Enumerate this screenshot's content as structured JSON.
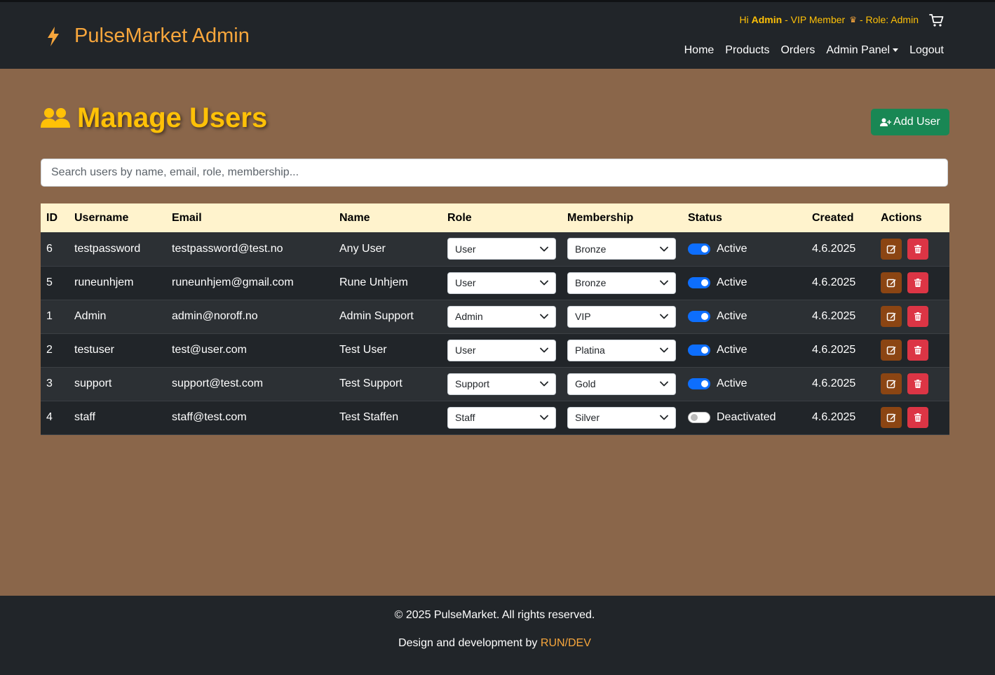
{
  "brand": {
    "title": "PulseMarket Admin"
  },
  "header": {
    "greeting_hi": "Hi",
    "user": "Admin",
    "membership_text": "- VIP Member",
    "role_text": "- Role: Admin"
  },
  "nav": {
    "home": "Home",
    "products": "Products",
    "orders": "Orders",
    "admin_panel": "Admin Panel",
    "logout": "Logout"
  },
  "page": {
    "title": "Manage Users",
    "add_user": "Add User"
  },
  "search": {
    "placeholder": "Search users by name, email, role, membership..."
  },
  "table": {
    "headers": [
      "ID",
      "Username",
      "Email",
      "Name",
      "Role",
      "Membership",
      "Status",
      "Created",
      "Actions"
    ],
    "rows": [
      {
        "id": "6",
        "username": "testpassword",
        "email": "testpassword@test.no",
        "name": "Any User",
        "role": "User",
        "membership": "Bronze",
        "status": "Active",
        "active": true,
        "created": "4.6.2025"
      },
      {
        "id": "5",
        "username": "runeunhjem",
        "email": "runeunhjem@gmail.com",
        "name": "Rune Unhjem",
        "role": "User",
        "membership": "Bronze",
        "status": "Active",
        "active": true,
        "created": "4.6.2025"
      },
      {
        "id": "1",
        "username": "Admin",
        "email": "admin@noroff.no",
        "name": "Admin Support",
        "role": "Admin",
        "membership": "VIP",
        "status": "Active",
        "active": true,
        "created": "4.6.2025"
      },
      {
        "id": "2",
        "username": "testuser",
        "email": "test@user.com",
        "name": "Test User",
        "role": "User",
        "membership": "Platina",
        "status": "Active",
        "active": true,
        "created": "4.6.2025"
      },
      {
        "id": "3",
        "username": "support",
        "email": "support@test.com",
        "name": "Test Support",
        "role": "Support",
        "membership": "Gold",
        "status": "Active",
        "active": true,
        "created": "4.6.2025"
      },
      {
        "id": "4",
        "username": "staff",
        "email": "staff@test.com",
        "name": "Test Staffen",
        "role": "Staff",
        "membership": "Silver",
        "status": "Deactivated",
        "active": false,
        "created": "4.6.2025"
      }
    ]
  },
  "footer": {
    "copyright": "© 2025 PulseMarket. All rights reserved.",
    "credit_prefix": "Design and development by",
    "credit_link": "RUN/DEV"
  },
  "colors": {
    "accent": "#ffc107",
    "brand": "#f7a63c",
    "nav_bg": "#212529",
    "page_bg": "#8a664a",
    "add_btn": "#198754",
    "edit_btn": "#8b4513",
    "delete_btn": "#dc3545",
    "toggle_on": "#0d6efd"
  }
}
